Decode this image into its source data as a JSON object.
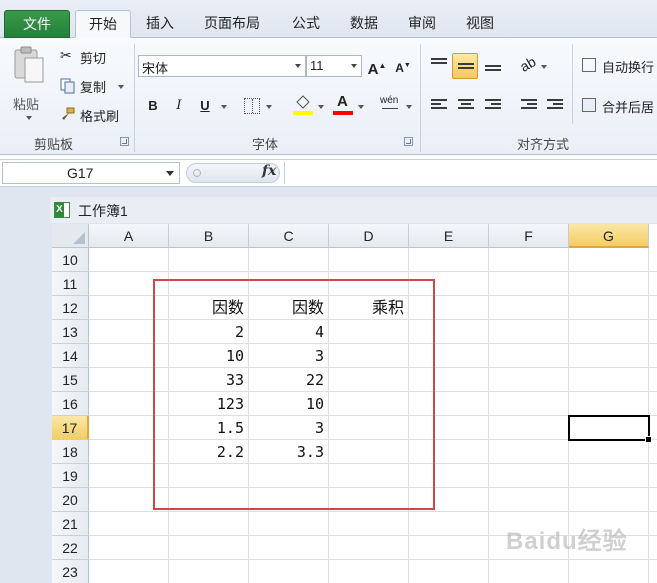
{
  "tabs": {
    "file": "文件",
    "home": "开始",
    "insert": "插入",
    "page_layout": "页面布局",
    "formulas": "公式",
    "data": "数据",
    "review": "审阅",
    "view": "视图"
  },
  "ribbon": {
    "clipboard": {
      "paste": "粘贴",
      "cut": "剪切",
      "copy": "复制",
      "format_painter": "格式刷",
      "group_label": "剪贴板"
    },
    "font": {
      "font_name": "宋体",
      "font_size": "11",
      "bold": "B",
      "italic": "I",
      "underline": "U",
      "grow": "A",
      "shrink": "A",
      "font_color_letter": "A",
      "phonetic": "wén",
      "group_label": "字体",
      "fill_color": "#ffff00",
      "text_color": "#ff0000"
    },
    "alignment": {
      "wrap_text": "自动换行",
      "merge_center": "合并后居",
      "group_label": "对齐方式"
    }
  },
  "formula_bar": {
    "name_box": "G17",
    "fx": "fx",
    "value": ""
  },
  "workbook": {
    "title": "工作簿1"
  },
  "sheet": {
    "columns": [
      "A",
      "B",
      "C",
      "D",
      "E",
      "F",
      "G"
    ],
    "active_column": "G",
    "rows": [
      "10",
      "11",
      "12",
      "13",
      "14",
      "15",
      "16",
      "17",
      "18",
      "19",
      "20",
      "21",
      "22",
      "23"
    ],
    "active_row": "17",
    "headers": {
      "b12": "因数",
      "c12": "因数",
      "d12": "乘积"
    },
    "values": {
      "b13": "2",
      "c13": "4",
      "b14": "10",
      "c14": "3",
      "b15": "33",
      "c15": "22",
      "b16": "123",
      "c16": "10",
      "b17": "1.5",
      "c17": "3",
      "b18": "2.2",
      "c18": "3.3"
    }
  },
  "watermark": "Baidu经验",
  "colors": {
    "file_tab": "#2a8a3e",
    "highlight_box": "#d0464a",
    "active_header": "#f4cd62"
  }
}
